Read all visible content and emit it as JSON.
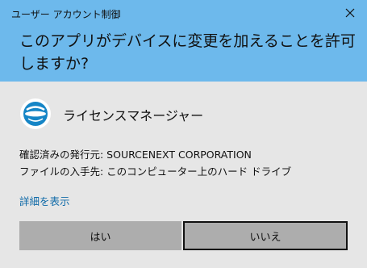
{
  "title_bar": {
    "title": "ユーザー アカウント制御"
  },
  "header": {
    "question": "このアプリがデバイスに変更を加えることを許可しますか?",
    "background_color": "#6db9ec"
  },
  "app": {
    "name": "ライセンスマネージャー",
    "icon": "sourcenext-logo-icon"
  },
  "info": {
    "publisher_line": "確認済みの発行元: SOURCENEXT CORPORATION",
    "origin_line": "ファイルの入手先: このコンピューター上のハード ドライブ"
  },
  "details_link": "詳細を表示",
  "buttons": {
    "yes": "はい",
    "no": "いいえ"
  },
  "colors": {
    "body_background": "#e6e6e6",
    "link": "#0f6aa8",
    "button": "#adadad"
  }
}
